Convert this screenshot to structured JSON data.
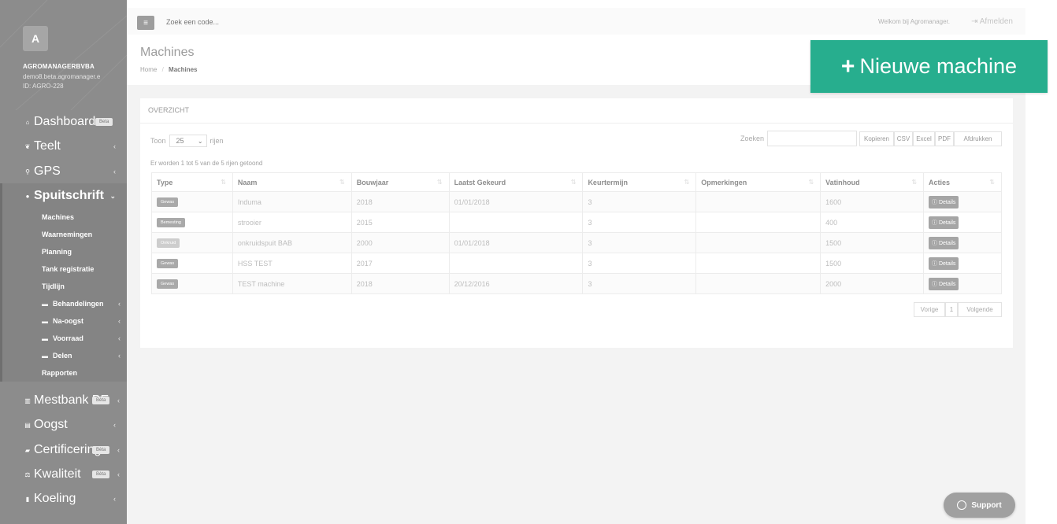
{
  "sidebar": {
    "avatar_letter": "A",
    "company": "AGROMANAGERBVBA",
    "email": "demo8.beta.agromanager.e",
    "client_id": "ID: AGRO-228",
    "items": [
      {
        "label": "Dashboard",
        "icon": "home-icon",
        "badge": "Beta"
      },
      {
        "label": "Teelt",
        "icon": "leaf-icon"
      },
      {
        "label": "GPS",
        "icon": "map-marker-icon"
      },
      {
        "label": "Spuitschrift",
        "icon": "droplet-icon"
      },
      {
        "label": "Mestbank BE",
        "icon": "bank-icon",
        "badge": "Bèta"
      },
      {
        "label": "Oogst",
        "icon": "truck-icon"
      },
      {
        "label": "Certificering",
        "icon": "certificate-icon",
        "badge": "Bèta"
      },
      {
        "label": "Kwaliteit",
        "icon": "balance-icon",
        "badge": "Bèta"
      },
      {
        "label": "Koeling",
        "icon": "thermometer-icon"
      }
    ],
    "sub_items": [
      {
        "label": "Machines"
      },
      {
        "label": "Waarnemingen"
      },
      {
        "label": "Planning"
      },
      {
        "label": "Tank registratie"
      },
      {
        "label": "Tijdlijn"
      },
      {
        "label": "Behandelingen"
      },
      {
        "label": "Na-oogst"
      },
      {
        "label": "Voorraad"
      },
      {
        "label": "Delen"
      },
      {
        "label": "Rapporten"
      }
    ]
  },
  "topbar": {
    "search_placeholder": "Zoek een code...",
    "welcome": "Welkom bij Agromanager.",
    "logout": "Afmelden"
  },
  "page": {
    "title": "Machines",
    "breadcrumb_home": "Home",
    "breadcrumb_current": "Machines",
    "new_button": "Nieuwe machine"
  },
  "panel": {
    "title": "OVERZICHT",
    "show_prefix": "Toon",
    "show_value": "25",
    "show_suffix": "rijen",
    "search_label": "Zoeken",
    "export_buttons": [
      "Kopieren",
      "CSV",
      "Excel",
      "PDF",
      "Afdrukken"
    ],
    "info": "Er worden 1 tot 5 van de 5 rijen getoond",
    "columns": [
      "Type",
      "Naam",
      "Bouwjaar",
      "Laatst Gekeurd",
      "Keurtermijn",
      "Opmerkingen",
      "Vatinhoud",
      "Acties"
    ],
    "rows": [
      {
        "type": "Gewas",
        "naam": "Induma",
        "bouwjaar": "2018",
        "gekeurd": "01/01/2018",
        "termijn": "3",
        "opmerkingen": "",
        "vatinhoud": "1600",
        "actie": "Details"
      },
      {
        "type": "Bemesting",
        "naam": "strooier",
        "bouwjaar": "2015",
        "gekeurd": "",
        "termijn": "3",
        "opmerkingen": "",
        "vatinhoud": "400",
        "actie": "Details"
      },
      {
        "type": "Onkruid",
        "naam": "onkruidspuit BAB",
        "bouwjaar": "2000",
        "gekeurd": "01/01/2018",
        "termijn": "3",
        "opmerkingen": "",
        "vatinhoud": "1500",
        "actie": "Details"
      },
      {
        "type": "Gewas",
        "naam": "HSS TEST",
        "bouwjaar": "2017",
        "gekeurd": "",
        "termijn": "3",
        "opmerkingen": "",
        "vatinhoud": "1500",
        "actie": "Details"
      },
      {
        "type": "Gewas",
        "naam": "TEST machine",
        "bouwjaar": "2018",
        "gekeurd": "20/12/2016",
        "termijn": "3",
        "opmerkingen": "",
        "vatinhoud": "2000",
        "actie": "Details"
      }
    ],
    "pager": {
      "prev": "Vorige",
      "page": "1",
      "next": "Volgende"
    }
  },
  "support": "Support",
  "colors": {
    "accent": "#27ae8e",
    "sidebar": "#8c8c8c"
  }
}
